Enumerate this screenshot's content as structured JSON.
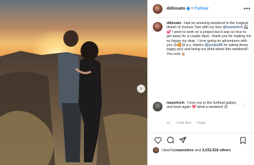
{
  "post": {
    "username": "ddlovato",
    "follow_label": "Follow",
    "more_label": "•••",
    "caption_user": "ddlovato",
    "caption_parts": [
      "Had an amazing weekend in the magical desert of Joshua Tree with my love ",
      "@maxehrich",
      " 🏜💕 I went to work on a project but it was so nice to get away for a couple days.. thank you for making me so happy my dear.. I love going on adventures with you 😍🥰😘 p.s. thanks ",
      "@lyndan89",
      " for taking these sappy pics and being our third wheel this weekend!! You rock 🤘🏼"
    ],
    "reply_user": "maxehrich",
    "reply_text": "I love you to the furthest galaxy and back again 💖 what a weekend 😍",
    "reply_time": "1d",
    "reply_likes": "7,095 likes",
    "reply_action": "Reply",
    "liked_by_prefix": "Liked by ",
    "liked_by_user": "maisiebov",
    "liked_by_mid": " and ",
    "liked_by_count": "3,032,918 others"
  },
  "icons": {
    "heart": "heart-icon",
    "comment": "comment-icon",
    "share": "share-icon",
    "save": "save-icon",
    "next": "chevron-right-icon"
  },
  "colors": {
    "link": "#3897f0",
    "mention": "#00376b",
    "muted": "#8e8e8e"
  }
}
